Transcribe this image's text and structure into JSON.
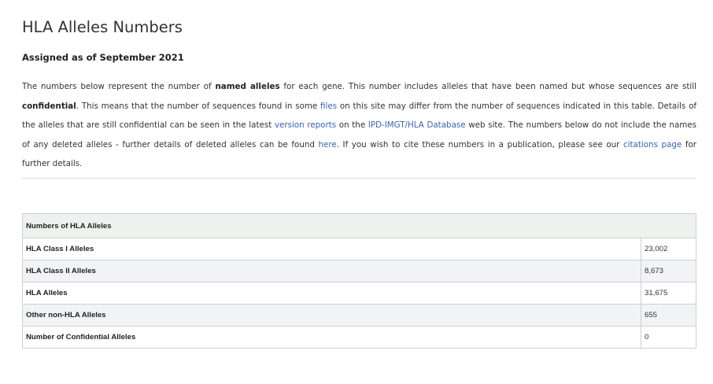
{
  "page": {
    "title": "HLA Alleles Numbers",
    "subtitle": "Assigned as of September 2021"
  },
  "intro": {
    "t1": "The numbers below represent the number of ",
    "b1": "named alleles",
    "t2": " for each gene. This number includes alleles that have been named but whose sequences are still ",
    "b2": "confidential",
    "t3": ". This means that the number of sequences found in some ",
    "link_files": "files",
    "t4": " on this site may differ from the number of sequences indicated in this table. Details of the alleles that are still confidential can be seen in the latest ",
    "link_version_reports": "version reports",
    "t5": " on the ",
    "link_database": "IPD-IMGT/HLA Database",
    "t6": " web site. The numbers below do not include the names of any deleted alleles - further details of deleted alleles can be found ",
    "link_here": "here",
    "t7": ". If you wish to cite these numbers in a publication, please see our ",
    "link_citations": "citations page",
    "t8": " for further details."
  },
  "table": {
    "header": "Numbers of HLA Alleles",
    "rows": [
      {
        "label": "HLA Class I Alleles",
        "value": "23,002"
      },
      {
        "label": "HLA Class II Alleles",
        "value": "8,673"
      },
      {
        "label": "HLA Alleles",
        "value": "31,675"
      },
      {
        "label": "Other non-HLA Alleles",
        "value": "655"
      },
      {
        "label": "Number of Confidential Alleles",
        "value": "0"
      }
    ]
  }
}
